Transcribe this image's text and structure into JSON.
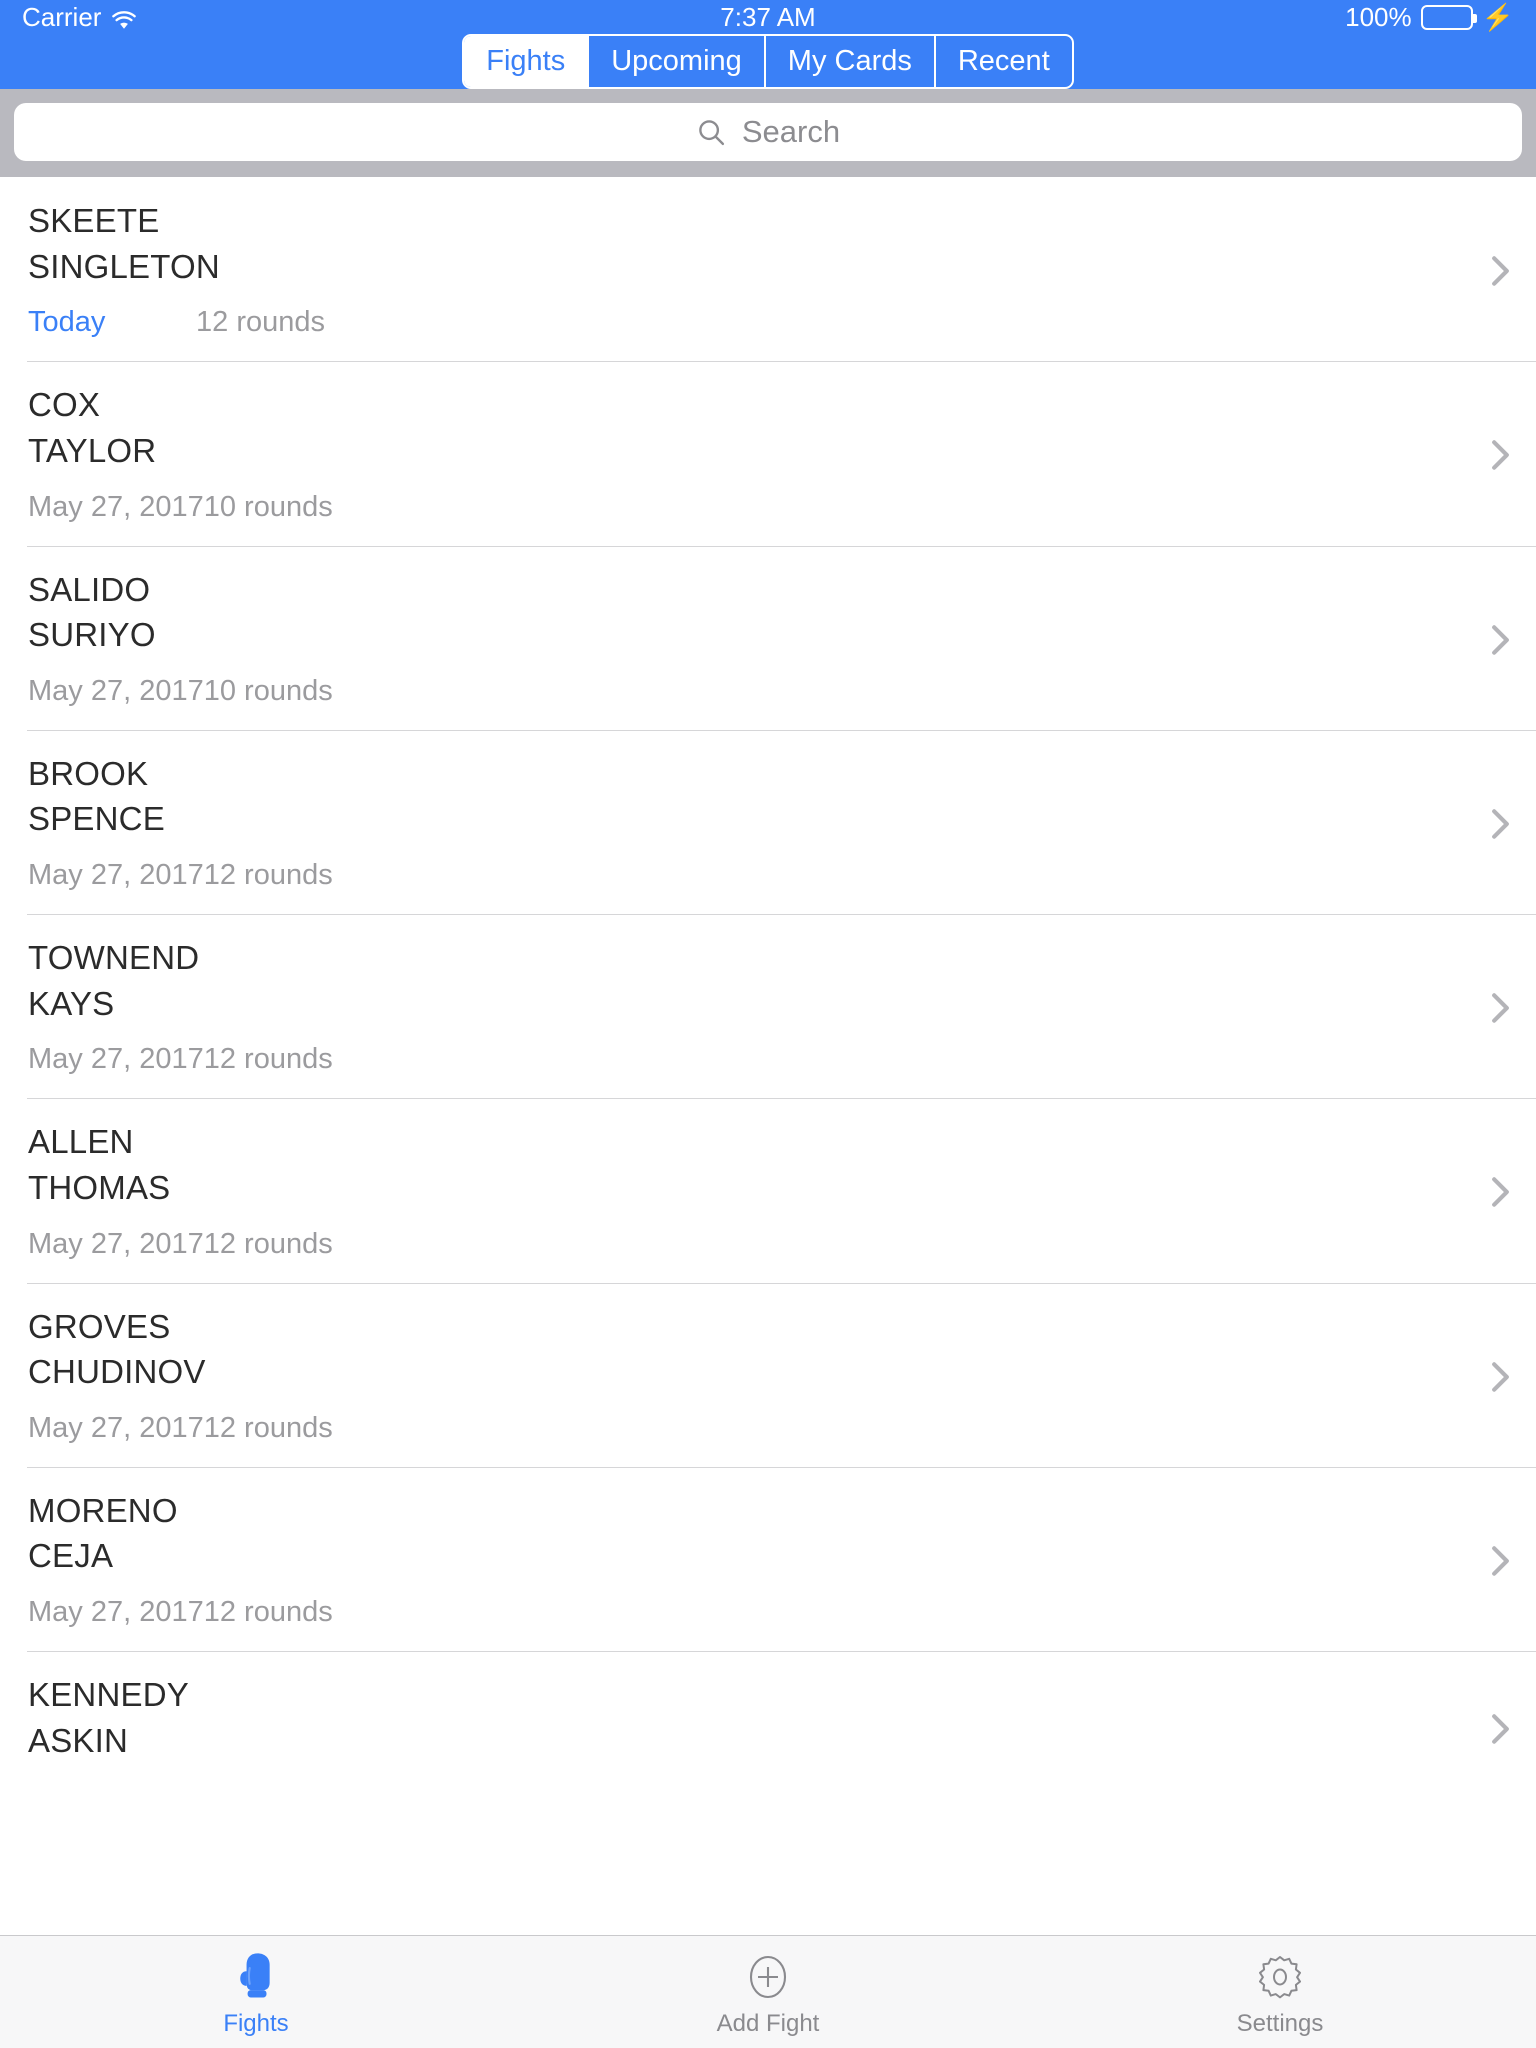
{
  "status_bar": {
    "carrier": "Carrier",
    "wifi_icon": "wifi-icon",
    "time": "7:37 AM",
    "battery_percent": "100%",
    "battery_icon": "battery-icon",
    "charging_icon": "lightning-bolt-icon",
    "accent_color": "#3a80f7",
    "battery_color": "#4cd964"
  },
  "segmented_control": {
    "options": [
      {
        "label": "Fights",
        "selected": true
      },
      {
        "label": "Upcoming",
        "selected": false
      },
      {
        "label": "My Cards",
        "selected": false
      },
      {
        "label": "Recent",
        "selected": false
      }
    ]
  },
  "search": {
    "placeholder": "Search",
    "value": "",
    "icon": "search-icon"
  },
  "list": {
    "chevron_icon": "chevron-right-icon",
    "rows": [
      {
        "fighter_a": "SKEETE",
        "fighter_b": "SINGLETON",
        "date": "Today",
        "date_is_today": true,
        "rounds": "12 rounds"
      },
      {
        "fighter_a": "COX",
        "fighter_b": "TAYLOR",
        "date": "May 27, 2017",
        "date_is_today": false,
        "rounds": "10 rounds"
      },
      {
        "fighter_a": "SALIDO",
        "fighter_b": "SURIYO",
        "date": "May 27, 2017",
        "date_is_today": false,
        "rounds": "10 rounds"
      },
      {
        "fighter_a": "BROOK",
        "fighter_b": "SPENCE",
        "date": "May 27, 2017",
        "date_is_today": false,
        "rounds": "12 rounds"
      },
      {
        "fighter_a": "TOWNEND",
        "fighter_b": "KAYS",
        "date": "May 27, 2017",
        "date_is_today": false,
        "rounds": "12 rounds"
      },
      {
        "fighter_a": "ALLEN",
        "fighter_b": "THOMAS",
        "date": "May 27, 2017",
        "date_is_today": false,
        "rounds": "12 rounds"
      },
      {
        "fighter_a": "GROVES",
        "fighter_b": "CHUDINOV",
        "date": "May 27, 2017",
        "date_is_today": false,
        "rounds": "12 rounds"
      },
      {
        "fighter_a": "MORENO",
        "fighter_b": "CEJA",
        "date": "May 27, 2017",
        "date_is_today": false,
        "rounds": "12 rounds"
      },
      {
        "fighter_a": "KENNEDY",
        "fighter_b": "ASKIN",
        "date": "",
        "date_is_today": false,
        "rounds": ""
      }
    ]
  },
  "tab_bar": {
    "tabs": [
      {
        "label": "Fights",
        "icon": "boxing-glove-icon",
        "active": true
      },
      {
        "label": "Add Fight",
        "icon": "plus-circle-icon",
        "active": false
      },
      {
        "label": "Settings",
        "icon": "gear-icon",
        "active": false
      }
    ]
  }
}
